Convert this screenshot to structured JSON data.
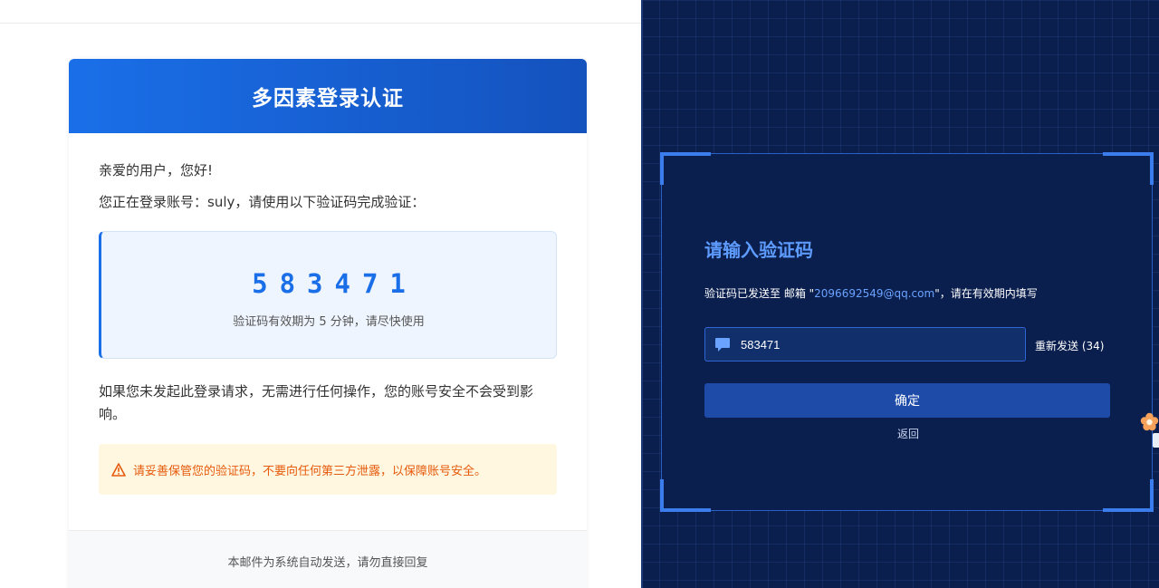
{
  "email": {
    "title": "多因素登录认证",
    "greeting": "亲爱的用户，您好!",
    "intro": "您正在登录账号：suly，请使用以下验证码完成验证：",
    "code": "583471",
    "code_note": "验证码有效期为 5 分钟，请尽快使用",
    "notice": "如果您未发起此登录请求，无需进行任何操作，您的账号安全不会受到影响。",
    "warning": "请妥善保管您的验证码，不要向任何第三方泄露，以保障账号安全。",
    "footer": "本邮件为系统自动发送，请勿直接回复"
  },
  "verify": {
    "title": "请输入验证码",
    "desc_prefix": "验证码已发送至 邮箱 \"",
    "desc_email": "2096692549@qq.com",
    "desc_suffix": "\"，请在有效期内填写",
    "code_value": "583471",
    "resend_label": "重新发送 (34)",
    "confirm_label": "确定",
    "back_label": "返回"
  },
  "colors": {
    "accent": "#1a6fe8",
    "panel_bg": "#0b1f4e",
    "warn_text": "#e65a0c",
    "warn_bg": "#fff7e0"
  },
  "icons": {
    "warning": "warning-triangle-icon",
    "input": "chat-bubble-icon",
    "widget": "flower-icon"
  }
}
